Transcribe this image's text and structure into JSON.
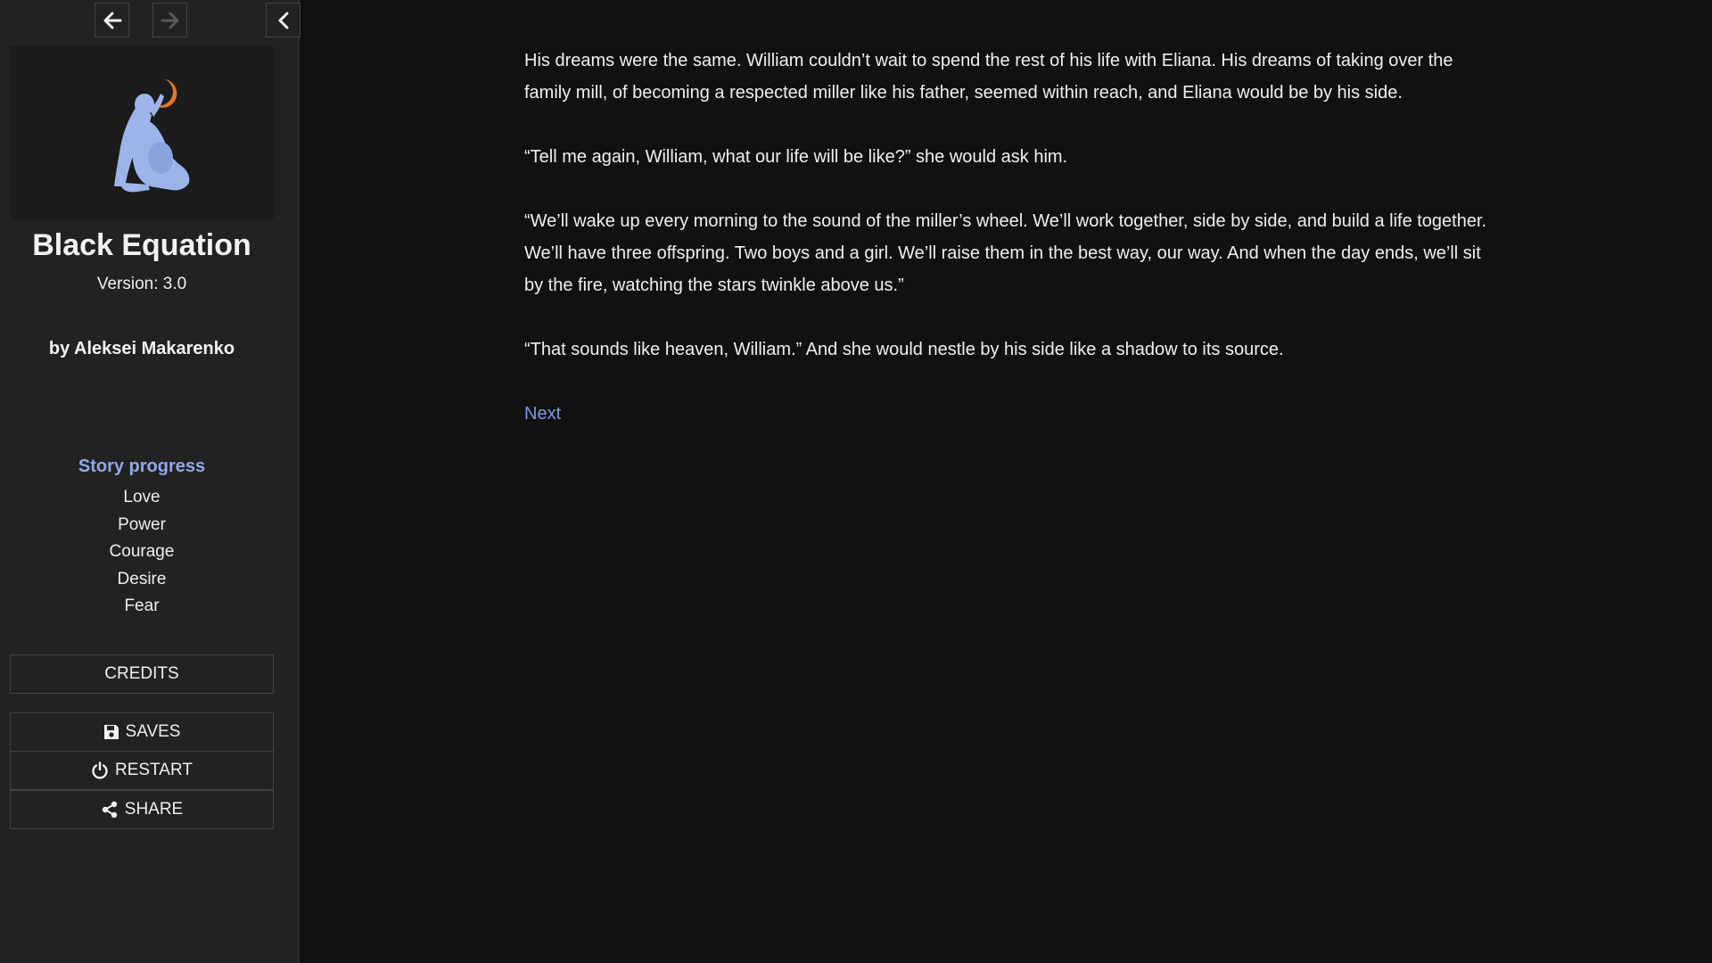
{
  "nav": {
    "back_icon": "arrow-left-icon",
    "forward_icon": "arrow-right-icon",
    "collapse_icon": "chevron-left-icon"
  },
  "sidebar": {
    "cover_icon": "seated-figure-with-moon-illustration",
    "title": "Black Equation",
    "version": "Version: 3.0",
    "author": "by Aleksei Makarenko",
    "progress_heading": "Story progress",
    "progress_items": [
      "Love",
      "Power",
      "Courage",
      "Desire",
      "Fear"
    ],
    "credits_label": "CREDITS",
    "saves_label": "SAVES",
    "restart_label": "RESTART",
    "share_label": "SHARE"
  },
  "passage": {
    "paragraphs": [
      "His dreams were the same. William couldn’t wait to spend the rest of his life with Eliana. His dreams of taking over the family mill, of becoming a respected miller like his father, seemed within reach, and Eliana would be by his side.",
      "“Tell me again, William, what our life will be like?” she would ask him.",
      "“We’ll wake up every morning to the sound of the miller’s wheel. We’ll work together, side by side, and build a life together. We’ll have three offspring. Two boys and a girl. We’ll raise them in the best way, our way. And when the day ends, we’ll sit by the fire, watching the stars twinkle above us.”",
      "“That sounds like heaven, William.” And she would nestle by his side like a shadow to its source."
    ],
    "next_label": "Next"
  },
  "colors": {
    "background": "#111111",
    "sidebar": "#222222",
    "accent_link": "#7f98e0",
    "progress_heading": "#8fa8e8",
    "figure": "#9db4ea",
    "moon": "#e8742a"
  }
}
